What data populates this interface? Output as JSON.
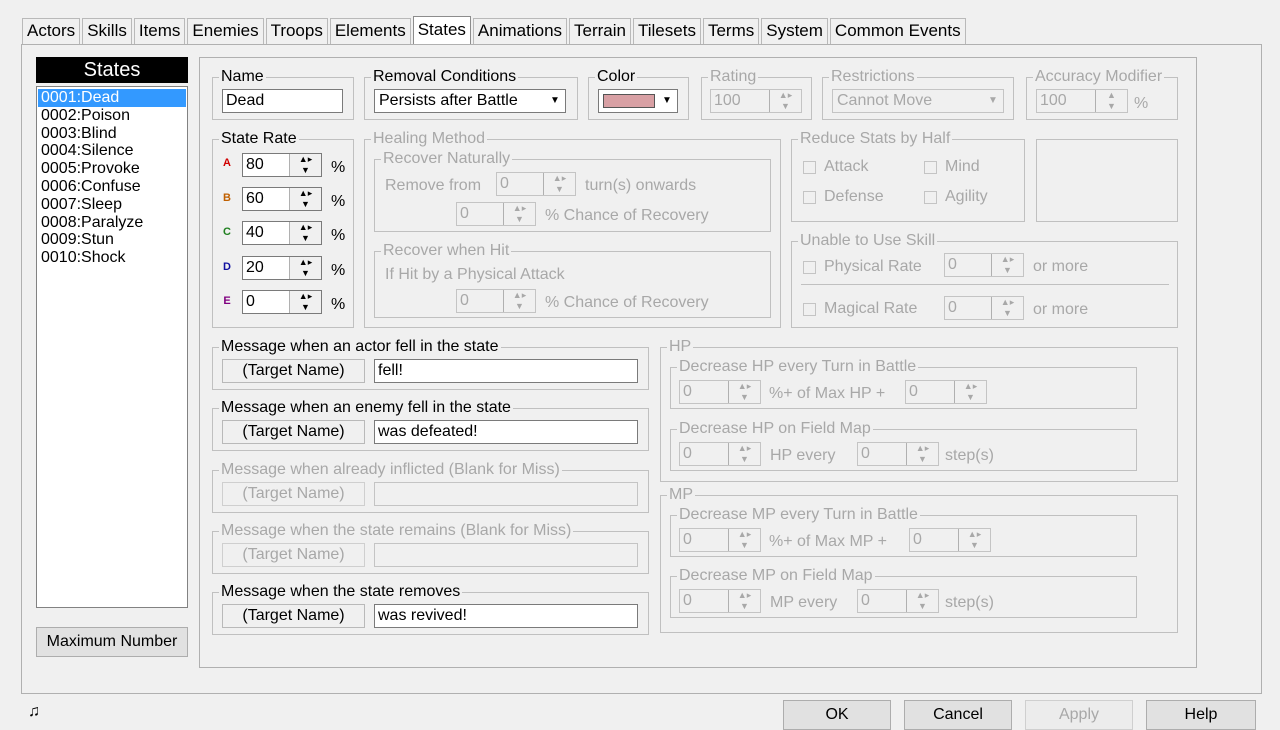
{
  "tabs": [
    "Actors",
    "Skills",
    "Items",
    "Enemies",
    "Troops",
    "Elements",
    "States",
    "Animations",
    "Terrain",
    "Tilesets",
    "Terms",
    "System",
    "Common Events"
  ],
  "list": {
    "header": "States",
    "items": [
      "0001:Dead",
      "0002:Poison",
      "0003:Blind",
      "0004:Silence",
      "0005:Provoke",
      "0006:Confuse",
      "0007:Sleep",
      "0008:Paralyze",
      "0009:Stun",
      "0010:Shock"
    ],
    "max_button": "Maximum Number"
  },
  "name": {
    "label": "Name",
    "value": "Dead"
  },
  "removal": {
    "label": "Removal Conditions",
    "value": "Persists after Battle"
  },
  "color": {
    "label": "Color",
    "swatch": "#d8a0a4"
  },
  "rating": {
    "label": "Rating",
    "value": "100"
  },
  "restrictions": {
    "label": "Restrictions",
    "value": "Cannot Move"
  },
  "accuracy": {
    "label": "Accuracy Modifier",
    "value": "100",
    "unit": "%"
  },
  "state_rate": {
    "label": "State Rate",
    "rows": [
      {
        "letter": "A",
        "value": "80",
        "color": "#d00000"
      },
      {
        "letter": "B",
        "value": "60",
        "color": "#c06000"
      },
      {
        "letter": "C",
        "value": "40",
        "color": "#208020"
      },
      {
        "letter": "D",
        "value": "20",
        "color": "#1010a0"
      },
      {
        "letter": "E",
        "value": "0",
        "color": "#800080"
      }
    ],
    "unit": "%"
  },
  "healing": {
    "label": "Healing Method",
    "natural": {
      "label": "Recover Naturally",
      "remove_from": "Remove from",
      "turns_value": "0",
      "turns_suffix": "turn(s) onwards",
      "chance_value": "0",
      "chance_suffix": "% Chance of Recovery"
    },
    "hit": {
      "label": "Recover when Hit",
      "desc": "If Hit by a Physical Attack",
      "chance_value": "0",
      "chance_suffix": "% Chance of Recovery"
    }
  },
  "reduce": {
    "label": "Reduce Stats by Half",
    "attack": "Attack",
    "mind": "Mind",
    "defense": "Defense",
    "agility": "Agility"
  },
  "unable": {
    "label": "Unable to Use Skill",
    "physical": "Physical Rate",
    "physical_value": "0",
    "magical": "Magical Rate",
    "magical_value": "0",
    "or_more": "or more"
  },
  "messages": {
    "target": "(Target Name)",
    "actor": {
      "label": "Message when an actor fell in the state",
      "value": "fell!"
    },
    "enemy": {
      "label": "Message when an enemy fell in the state",
      "value": "was defeated!"
    },
    "already": {
      "label": "Message when already inflicted (Blank for Miss)",
      "value": ""
    },
    "remains": {
      "label": "Message when the state remains (Blank for Miss)",
      "value": ""
    },
    "removes": {
      "label": "Message when the state removes",
      "value": "was revived!"
    }
  },
  "hp": {
    "label": "HP",
    "battle": {
      "label": "Decrease HP every Turn in Battle",
      "v1": "0",
      "mid": "%+ of Max HP +",
      "v2": "0"
    },
    "field": {
      "label": "Decrease HP on Field Map",
      "v1": "0",
      "mid": "HP every",
      "v2": "0",
      "end": "step(s)"
    }
  },
  "mp": {
    "label": "MP",
    "battle": {
      "label": "Decrease MP every Turn in Battle",
      "v1": "0",
      "mid": "%+ of Max MP +",
      "v2": "0"
    },
    "field": {
      "label": "Decrease MP on Field Map",
      "v1": "0",
      "mid": "MP every",
      "v2": "0",
      "end": "step(s)"
    }
  },
  "buttons": {
    "ok": "OK",
    "cancel": "Cancel",
    "apply": "Apply",
    "help": "Help"
  },
  "status_icon": "music-note-icon"
}
